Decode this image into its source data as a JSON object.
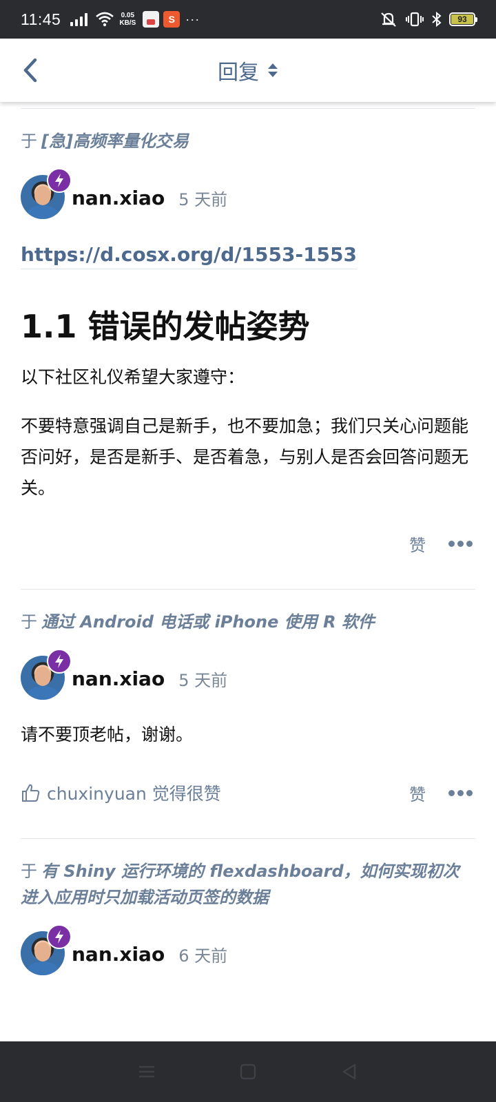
{
  "status_bar": {
    "time": "11:45",
    "net_speed_value": "0.05",
    "net_speed_unit": "KB/S",
    "shop_app_letter": "S",
    "more": "···",
    "battery": "93"
  },
  "header": {
    "title": "回复"
  },
  "posts": [
    {
      "context_prefix": "于",
      "context_topic": "[急]高频率量化交易",
      "author": "nan.xiao",
      "time": "5 天前",
      "link": "https://d.cosx.org/d/1553-1553",
      "heading": "1.1 错误的发帖姿势",
      "paragraphs": [
        "以下社区礼仪希望大家遵守：",
        "不要特意强调自己是新手，也不要加急；我们只关心问题能否问好，是否是新手、是否着急，与别人是否会回答问题无关。"
      ],
      "like_label": "赞"
    },
    {
      "context_prefix": "于",
      "context_topic": "通过 Android 电话或 iPhone 使用 R 软件",
      "author": "nan.xiao",
      "time": "5 天前",
      "paragraphs": [
        "请不要顶老帖，谢谢。"
      ],
      "liked_by": "chuxinyuan 觉得很赞",
      "like_label": "赞"
    },
    {
      "context_prefix": "于",
      "context_topic": "有 Shiny 运行环境的 flexdashboard，如何实现初次进入应用时只加载活动页签的数据",
      "author": "nan.xiao",
      "time": "6 天前"
    }
  ],
  "colors": {
    "accent": "#4d698e",
    "muted": "#6b7f99",
    "badge": "#7b2fa4",
    "system_bar": "#2b2c30"
  }
}
